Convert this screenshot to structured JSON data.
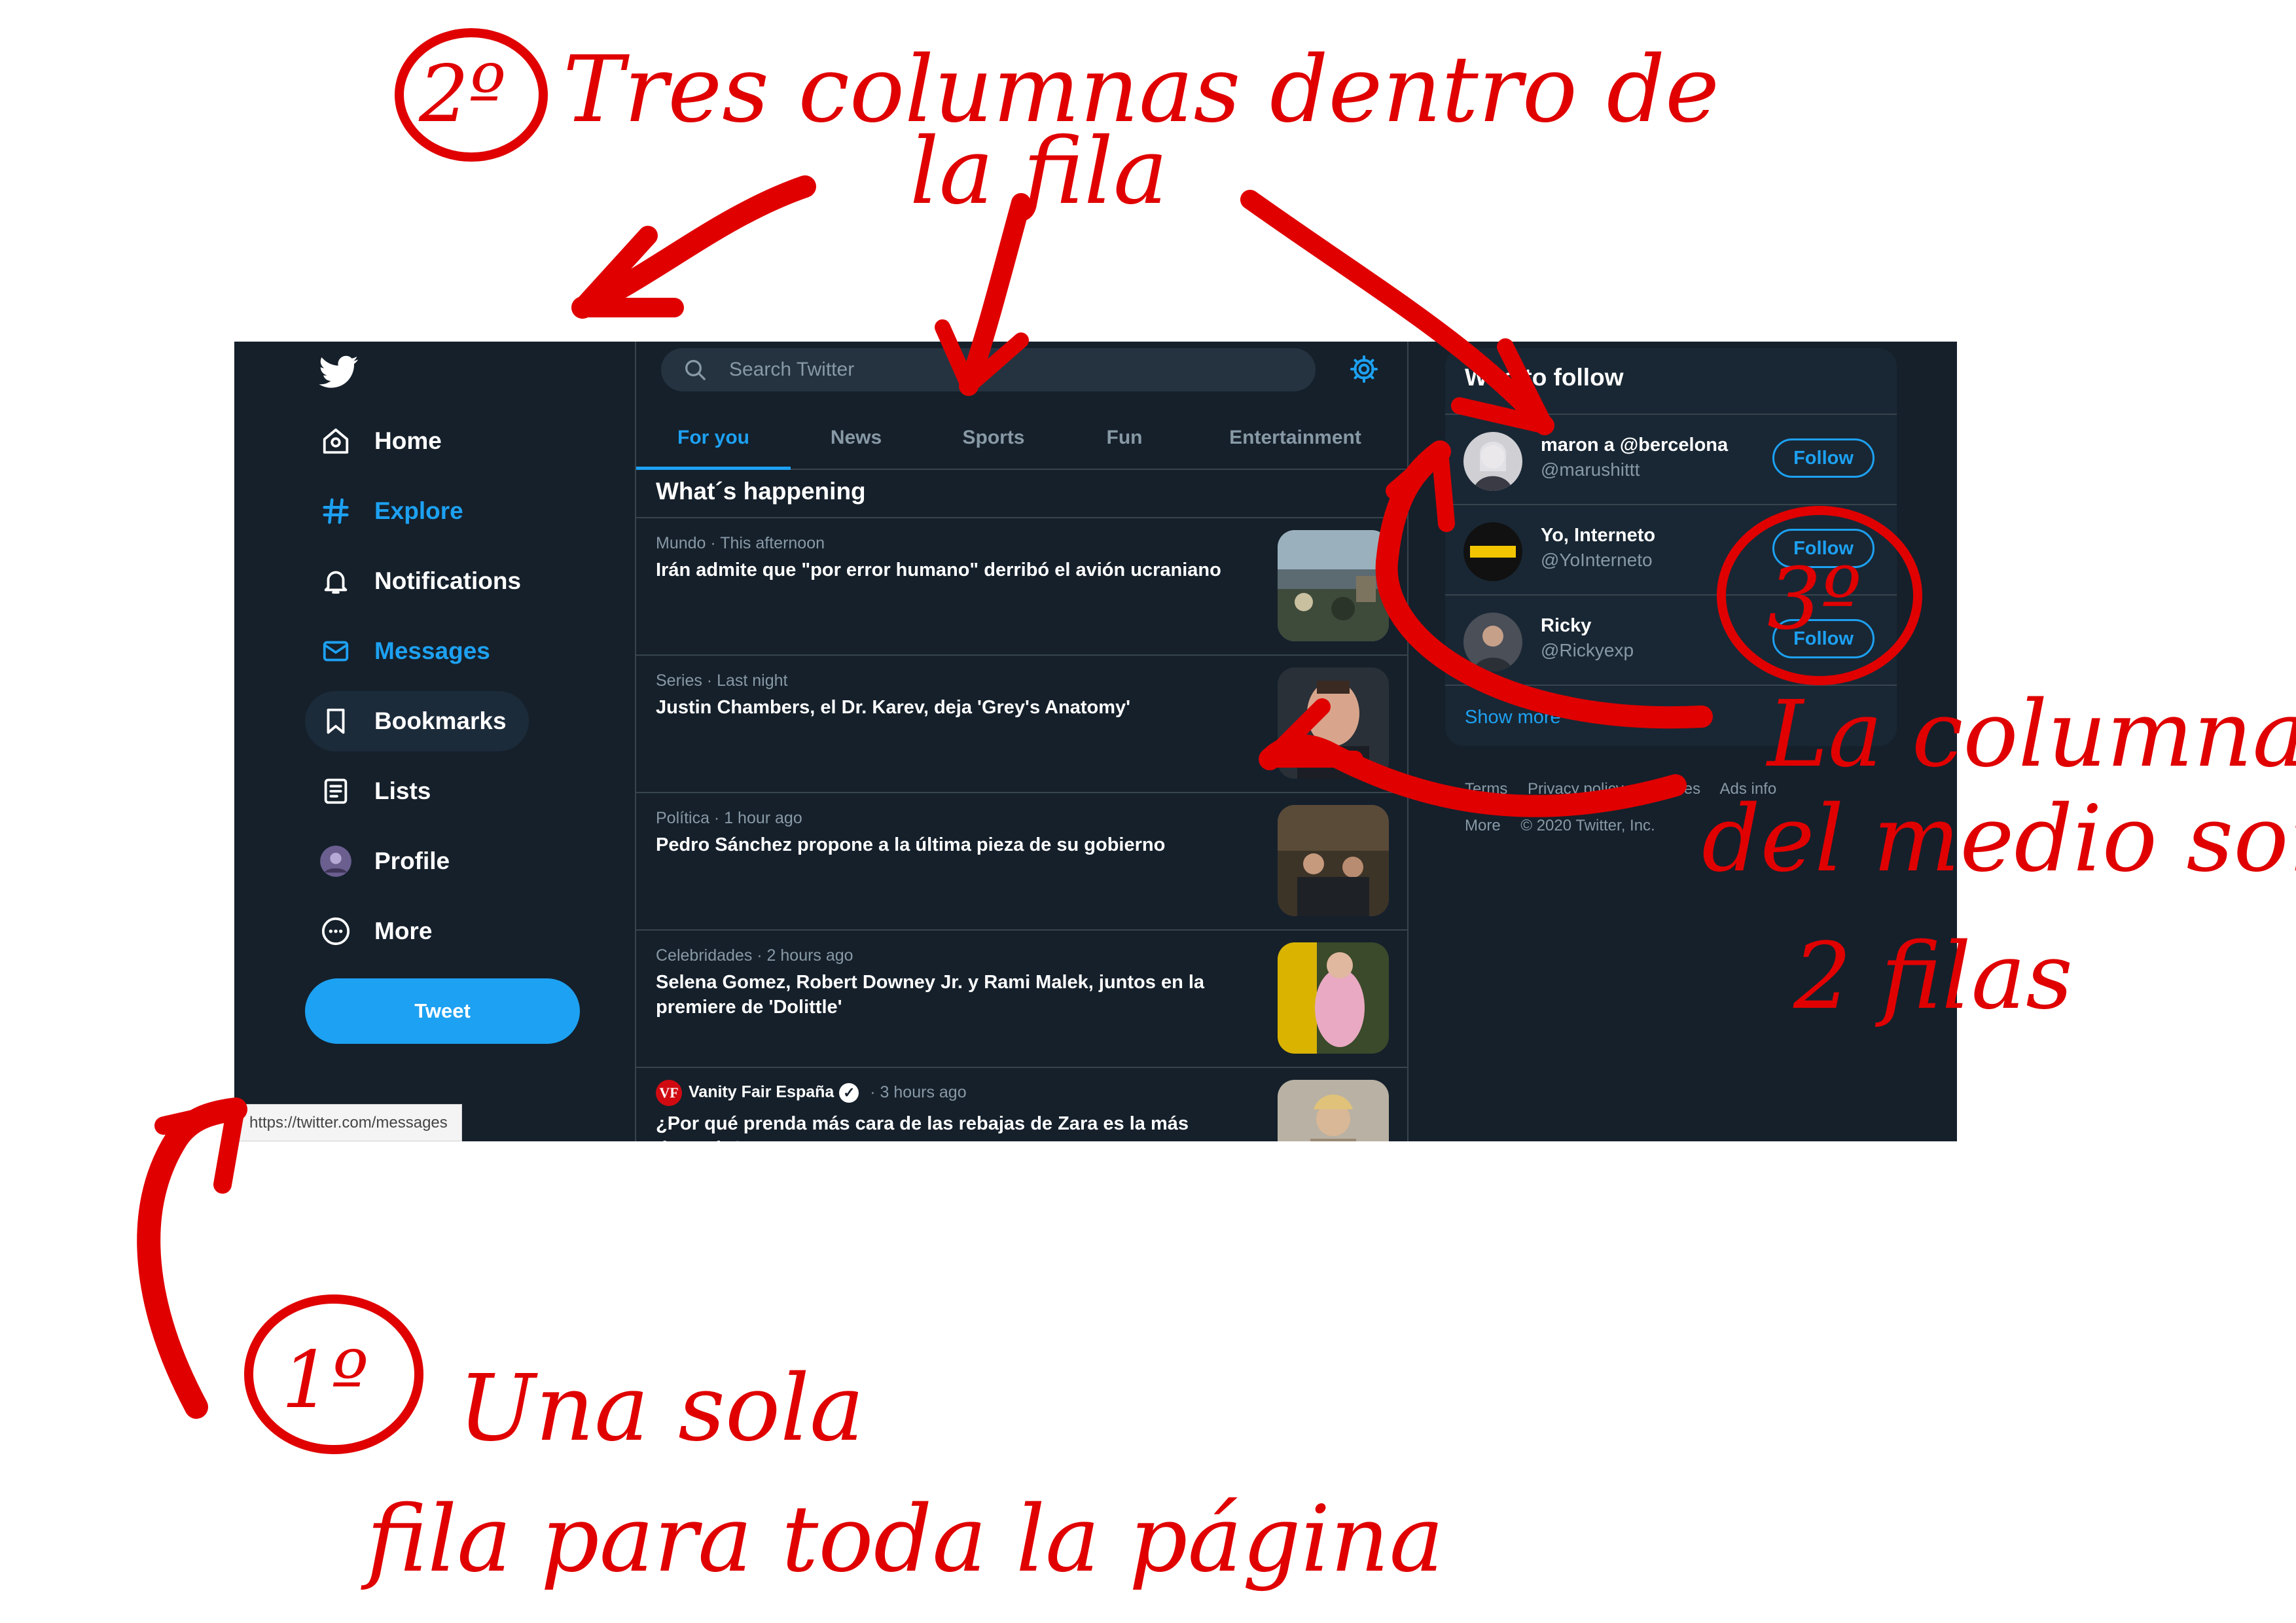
{
  "sidebar": {
    "items": [
      {
        "label": "Home"
      },
      {
        "label": "Explore"
      },
      {
        "label": "Notifications"
      },
      {
        "label": "Messages"
      },
      {
        "label": "Bookmarks"
      },
      {
        "label": "Lists"
      },
      {
        "label": "Profile"
      },
      {
        "label": "More"
      }
    ],
    "tweet_label": "Tweet"
  },
  "status_bar": {
    "url": "https://twitter.com/messages"
  },
  "search": {
    "placeholder": "Search Twitter"
  },
  "tabs": [
    "For you",
    "News",
    "Sports",
    "Fun",
    "Entertainment"
  ],
  "main": {
    "section_title": "What´s happening",
    "trends": [
      {
        "meta": "Mundo · This afternoon",
        "title": "Irán admite que \"por error humano\" derribó el avión ucraniano"
      },
      {
        "meta": "Series · Last night",
        "title": "Justin Chambers, el Dr. Karev, deja 'Grey's Anatomy'"
      },
      {
        "meta": "Política · 1 hour ago",
        "title": "Pedro Sánchez propone a la última pieza de su gobierno"
      },
      {
        "meta": "Celebridades · 2 hours ago",
        "title": "Selena Gomez, Robert Downey Jr. y Rami Malek, juntos en la premiere de 'Dolittle'"
      },
      {
        "source": "Vanity Fair España",
        "source_logo": "VF",
        "time": "· 3 hours ago",
        "title": "¿Por qué prenda más cara de las rebajas de Zara es la más deseada?"
      }
    ]
  },
  "who_to_follow": {
    "title": "Who to follow",
    "users": [
      {
        "name": "maron a @bercelona",
        "handle": "@marushittt",
        "button": "Follow"
      },
      {
        "name": "Yo, Interneto",
        "handle": "@YoInterneto",
        "button": "Follow"
      },
      {
        "name": "Ricky",
        "handle": "@Rickyexp",
        "button": "Follow"
      }
    ],
    "show_more": "Show more"
  },
  "footer": {
    "line1": [
      "Terms",
      "Privacy policy",
      "Cookies",
      "Ads info"
    ],
    "line2": [
      "More",
      "© 2020 Twitter, Inc."
    ]
  },
  "annotations": {
    "note1_number": "1º",
    "note1_line1": "Una sola",
    "note1_line2": "fila para toda la página",
    "note2_number": "2º",
    "note2_line1": "Tres columnas dentro de",
    "note2_line2": "la fila",
    "note3_number": "3º",
    "note3_line1": "La columna",
    "note3_line2": "del medio son",
    "note3_line3": "2 filas",
    "color": "#e00000"
  },
  "colors": {
    "background": "#15202b",
    "panel": "#192734",
    "accent": "#1da1f2",
    "muted": "#8899a6",
    "border": "#38444d"
  }
}
